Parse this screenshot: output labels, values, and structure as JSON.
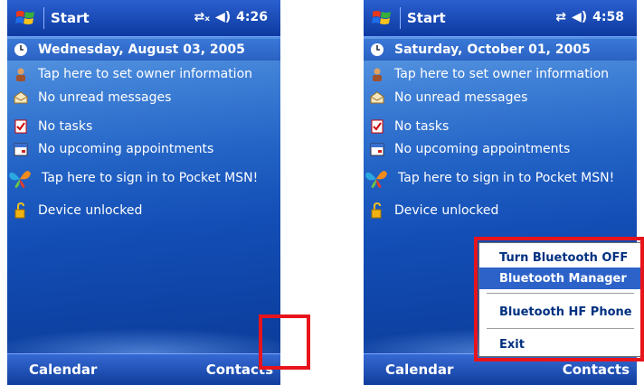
{
  "left": {
    "start_label": "Start",
    "time": "4:26",
    "date": "Wednesday, August 03, 2005",
    "items": [
      {
        "icon": "owner-icon",
        "label": "Tap here to set owner information"
      },
      {
        "icon": "mail-icon",
        "label": "No unread messages"
      },
      {
        "icon": "tasks-icon",
        "label": "No tasks"
      },
      {
        "icon": "calendar-icon",
        "label": "No upcoming appointments"
      },
      {
        "icon": "msn-butterfly-icon",
        "label": "Tap here to sign in to Pocket MSN!"
      },
      {
        "icon": "lock-icon",
        "label": "Device unlocked"
      }
    ],
    "softkey_left": "Calendar",
    "softkey_right": "Contacts"
  },
  "right": {
    "start_label": "Start",
    "time": "4:58",
    "date": "Saturday, October 01, 2005",
    "items": [
      {
        "icon": "owner-icon",
        "label": "Tap here to set owner information"
      },
      {
        "icon": "mail-icon",
        "label": "No unread messages"
      },
      {
        "icon": "tasks-icon",
        "label": "No tasks"
      },
      {
        "icon": "calendar-icon",
        "label": "No upcoming appointments"
      },
      {
        "icon": "msn-butterfly-icon",
        "label": "Tap here to sign in to Pocket MSN!"
      },
      {
        "icon": "lock-icon",
        "label": "Device unlocked"
      }
    ],
    "menu": {
      "items": [
        "Turn Bluetooth OFF",
        "Bluetooth Manager",
        "Bluetooth HF Phone",
        "Exit"
      ],
      "selected": "Bluetooth Manager"
    },
    "softkey_left": "Calendar",
    "softkey_right": "Contacts"
  },
  "colors": {
    "highlight": "#e8141b",
    "accent": "#0d3aa0"
  }
}
